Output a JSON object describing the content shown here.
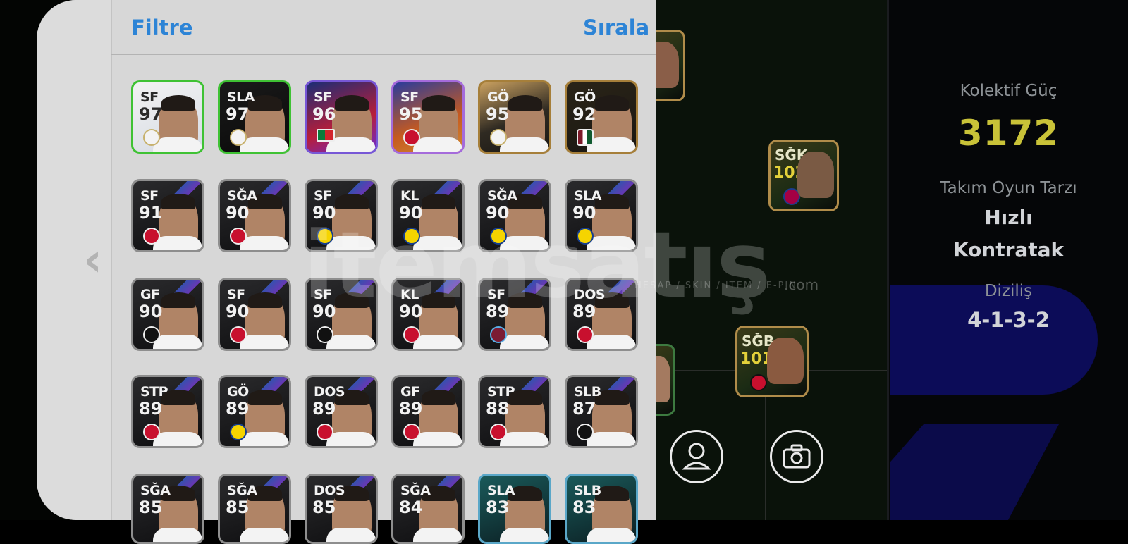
{
  "header": {
    "filter_label": "Filtre",
    "sort_label": "Sırala"
  },
  "players": [
    {
      "pos": "SF",
      "rating": "97",
      "style": "green",
      "club": "rm"
    },
    {
      "pos": "SLA",
      "rating": "97",
      "style": "green2",
      "club": "rm"
    },
    {
      "pos": "SF",
      "rating": "96",
      "style": "blue",
      "club": "pt"
    },
    {
      "pos": "SF",
      "rating": "95",
      "style": "purple",
      "club": "gs"
    },
    {
      "pos": "GÖ",
      "rating": "95",
      "style": "gold",
      "club": "rm"
    },
    {
      "pos": "GÖ",
      "rating": "92",
      "style": "gold2",
      "club": "flu"
    },
    {
      "pos": "SF",
      "rating": "91",
      "style": "std",
      "club": "gs"
    },
    {
      "pos": "SĞA",
      "rating": "90",
      "style": "std",
      "club": "gs"
    },
    {
      "pos": "SF",
      "rating": "90",
      "style": "std",
      "club": "fb"
    },
    {
      "pos": "KL",
      "rating": "90",
      "style": "std",
      "club": "fb"
    },
    {
      "pos": "SĞA",
      "rating": "90",
      "style": "std",
      "club": "fb"
    },
    {
      "pos": "SLA",
      "rating": "90",
      "style": "std",
      "club": "fb"
    },
    {
      "pos": "GF",
      "rating": "90",
      "style": "std",
      "club": "bjk"
    },
    {
      "pos": "SF",
      "rating": "90",
      "style": "std",
      "club": "gs"
    },
    {
      "pos": "SF",
      "rating": "90",
      "style": "std",
      "club": "bjk"
    },
    {
      "pos": "KL",
      "rating": "90",
      "style": "std",
      "club": "gs"
    },
    {
      "pos": "SF",
      "rating": "89",
      "style": "std",
      "club": "ts"
    },
    {
      "pos": "DOS",
      "rating": "89",
      "style": "std",
      "club": "gs"
    },
    {
      "pos": "STP",
      "rating": "89",
      "style": "std",
      "club": "gs"
    },
    {
      "pos": "GÖ",
      "rating": "89",
      "style": "std",
      "club": "fb"
    },
    {
      "pos": "DOS",
      "rating": "89",
      "style": "std",
      "club": "gs"
    },
    {
      "pos": "GF",
      "rating": "89",
      "style": "std",
      "club": "gs"
    },
    {
      "pos": "STP",
      "rating": "88",
      "style": "std",
      "club": "gs"
    },
    {
      "pos": "SLB",
      "rating": "87",
      "style": "std",
      "club": "bjk"
    },
    {
      "pos": "SĞA",
      "rating": "85",
      "style": "std",
      "club": "afc"
    },
    {
      "pos": "SĞA",
      "rating": "85",
      "style": "std",
      "club": "atm"
    },
    {
      "pos": "DOS",
      "rating": "85",
      "style": "std",
      "club": "mci"
    },
    {
      "pos": "SĞA",
      "rating": "84",
      "style": "std",
      "club": "pt"
    },
    {
      "pos": "SLA",
      "rating": "83",
      "style": "teal",
      "club": "gs"
    },
    {
      "pos": "SLB",
      "rating": "83",
      "style": "teal",
      "club": "gs"
    }
  ],
  "field_cards": [
    {
      "pos": "SĞK",
      "rating": "102"
    },
    {
      "pos": "SĞB",
      "rating": "101"
    }
  ],
  "stats": {
    "collective_label": "Kolektif Güç",
    "collective_value": "3172",
    "style_label": "Takım Oyun Tarzı",
    "style_value_1": "Hızlı",
    "style_value_2": "Kontratak",
    "formation_label": "Diziliş",
    "formation_value": "4-1-3-2"
  },
  "watermark": {
    "main": "itemsatış",
    "sub": "HESAP / SKIN / ITEM / E-PIN",
    "com": ".com"
  },
  "icons": {
    "back": "chevron-left-icon",
    "profile": "person-icon",
    "camera": "camera-icon"
  },
  "colors": {
    "accent": "#2d84d6",
    "power": "#c9c238"
  }
}
